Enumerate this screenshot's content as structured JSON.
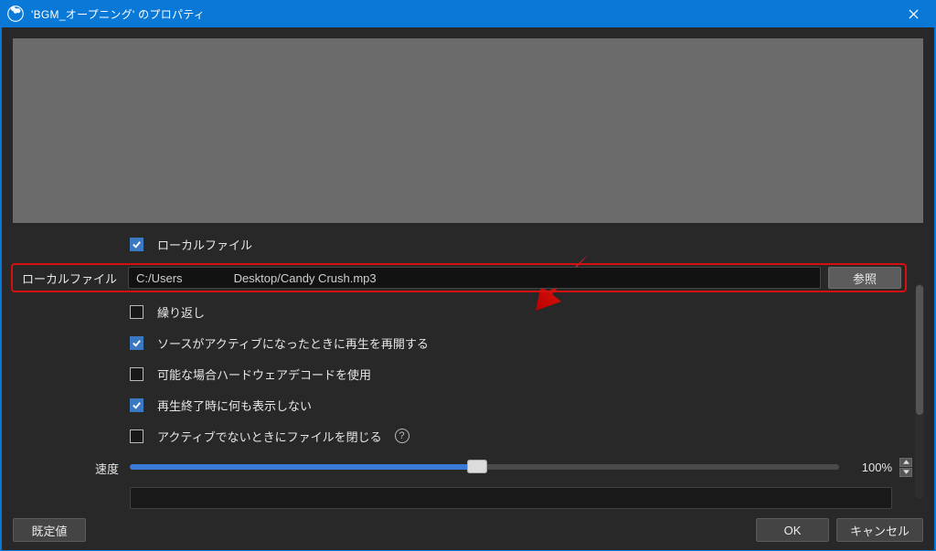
{
  "window": {
    "title": "'BGM_オープニング' のプロパティ"
  },
  "options": {
    "local_file_chk": "ローカルファイル",
    "local_file_label": "ローカルファイル",
    "path_seg1": "C:/Users",
    "path_seg2": "Desktop/Candy Crush.mp3",
    "browse": "参照",
    "loop": "繰り返し",
    "restart_playback": "ソースがアクティブになったときに再生を再開する",
    "hw_decode": "可能な場合ハードウェアデコードを使用",
    "show_nothing": "再生終了時に何も表示しない",
    "close_when_inactive": "アクティブでないときにファイルを閉じる",
    "speed_label": "速度",
    "speed_value": "100%",
    "cutoff_label": " ",
    "cutoff_value": " "
  },
  "footer": {
    "defaults": "既定値",
    "ok": "OK",
    "cancel": "キャンセル"
  }
}
